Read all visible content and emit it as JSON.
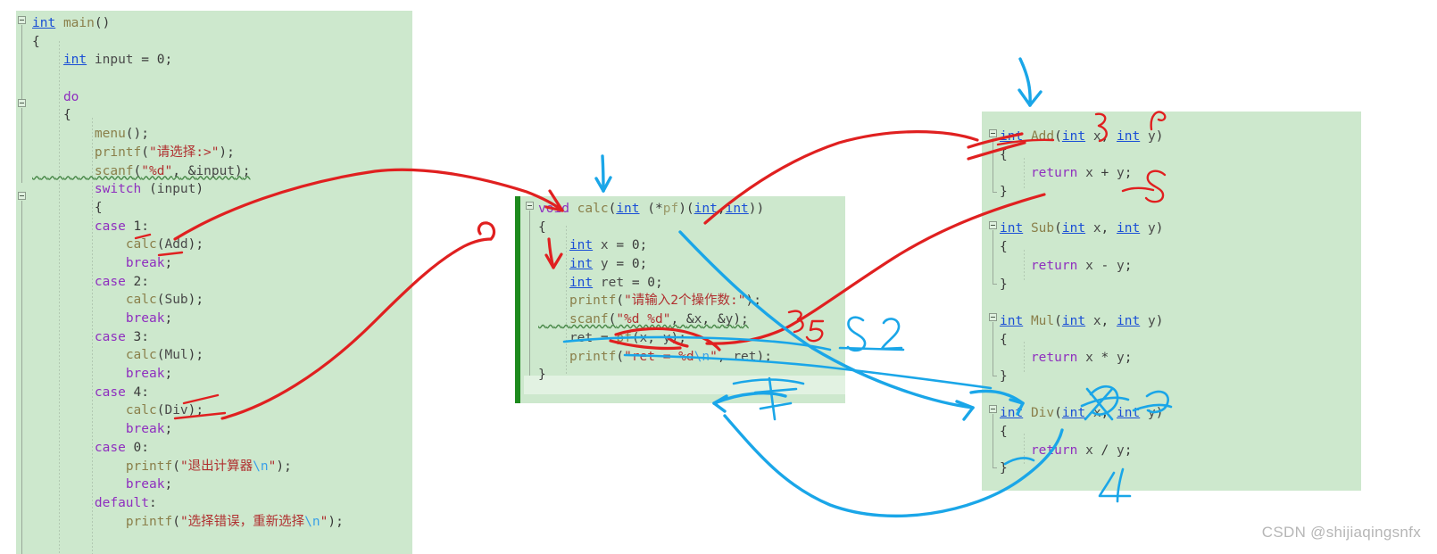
{
  "watermark": "CSDN @shijiaqingsnfx",
  "colors": {
    "panel_background": "#cde8cd",
    "page_background": "#ffffff",
    "keyword": "#8f2fbf",
    "type": "#1a4fd6",
    "function": "#8a7f4a",
    "string": "#b03030",
    "escape": "#3aa0e8",
    "change_bar": "#1d8a1d",
    "annotation_red": "#e02020",
    "annotation_blue": "#1aa6e8",
    "watermark_text": "#b6b6b6"
  },
  "left_panel": {
    "name": "main-function-code",
    "lines": [
      "int main()",
      "{",
      "    int input = 0;",
      "",
      "    do",
      "    {",
      "        menu();",
      "        printf(\"请选择:>\");",
      "        scanf(\"%d\", &input);",
      "        switch (input)",
      "        {",
      "        case 1:",
      "            calc(Add);",
      "            break;",
      "        case 2:",
      "            calc(Sub);",
      "            break;",
      "        case 3:",
      "            calc(Mul);",
      "            break;",
      "        case 4:",
      "            calc(Div);",
      "            break;",
      "        case 0:",
      "            printf(\"退出计算器\\n\");",
      "            break;",
      "        default:",
      "            printf(\"选择错误，重新选择\\n\");"
    ]
  },
  "middle_panel": {
    "name": "calc-function-code",
    "lines": [
      "void calc(int (*pf)(int,int))",
      "{",
      "    int x = 0;",
      "    int y = 0;",
      "    int ret = 0;",
      "    printf(\"请输入2个操作数:\");",
      "    scanf(\"%d %d\", &x, &y);",
      "    ret = pf(x, y);",
      "    printf(\"ret = %d\\n\", ret);",
      "}"
    ]
  },
  "right_panel": {
    "name": "operation-functions-code",
    "functions": [
      {
        "signature": "int Add(int x, int y)",
        "body": "return x + y;"
      },
      {
        "signature": "int Sub(int x, int y)",
        "body": "return x - y;"
      },
      {
        "signature": "int Mul(int x, int y)",
        "body": "return x * y;"
      },
      {
        "signature": "int Div(int x, int y)",
        "body": "return x / y;"
      }
    ]
  },
  "annotations": {
    "blue_numbers": "8 2",
    "red_marks": [
      "3",
      "5",
      "8",
      "5"
    ],
    "blue_marks": [
      "4"
    ],
    "description": "Hand-drawn red and blue arrows linking calc(Add/Sub/Mul/Div) calls to the calc function and to the Add/Sub/Mul/Div definitions"
  }
}
